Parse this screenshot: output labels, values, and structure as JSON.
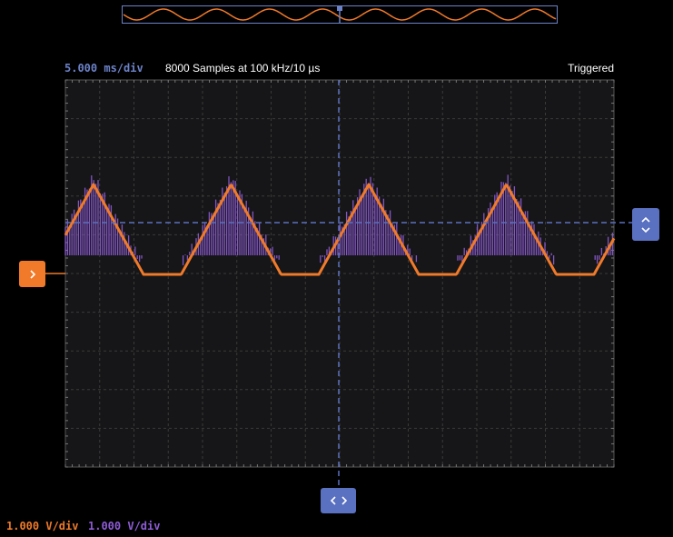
{
  "header": {
    "timebase": "5.000 ms/div",
    "samples": "8000 Samples at 100 kHz/10 µs",
    "status": "Triggered"
  },
  "channels": [
    {
      "scale": "1.000 V/div",
      "color": "#f07a2a"
    },
    {
      "scale": "1.000 V/div",
      "color": "#8e5cd6"
    }
  ],
  "colors": {
    "grid_bg": "#161618",
    "grid_line": "#3a3a3a",
    "cursor": "#5a70c0",
    "trace1": "#f07a2a",
    "trace2": "#8e5cd6"
  },
  "icons": {
    "trigger": "chevron-right-icon",
    "level": "chevron-up-down-icon",
    "position": "chevron-left-right-icon"
  }
}
